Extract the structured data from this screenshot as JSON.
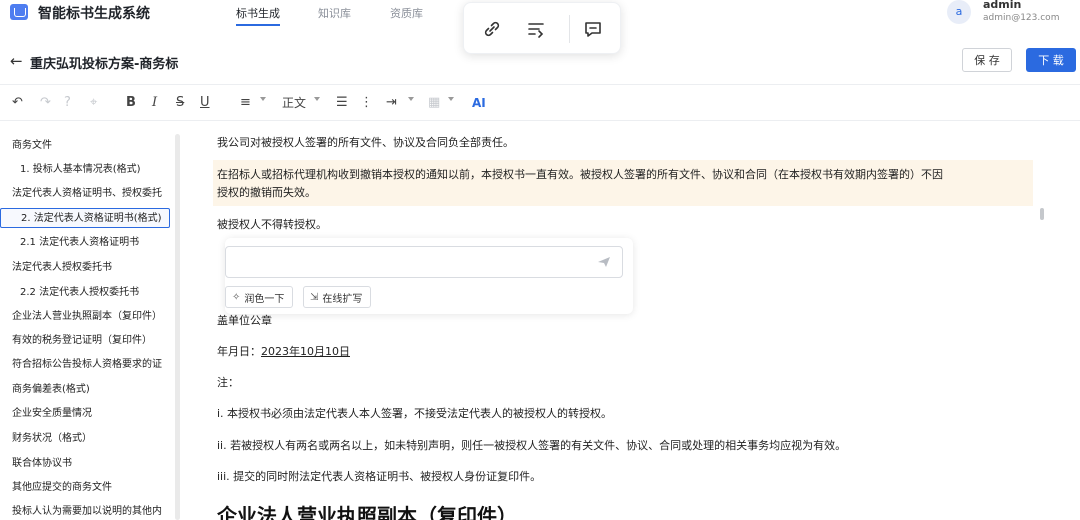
{
  "app": {
    "title": "智能标书生成系统",
    "tabs": [
      {
        "label": "标书生成",
        "active": true
      },
      {
        "label": "知识库",
        "active": false
      },
      {
        "label": "资质库",
        "active": false
      }
    ]
  },
  "user": {
    "avatar_letter": "a",
    "name": "admin",
    "email": "admin@123.com"
  },
  "popover": {
    "icons": [
      "link-icon",
      "rewrite-icon",
      "comment-icon"
    ]
  },
  "doc": {
    "title": "重庆弘玑投标方案-商务标",
    "save_label": "保 存",
    "download_label": "下 载"
  },
  "toolbar": {
    "paragraph_style": "正文",
    "ai_label": "AI",
    "bold": "B",
    "italic": "I",
    "strike": "S",
    "underline": "U"
  },
  "outline": [
    {
      "label": "商务文件",
      "level": 1
    },
    {
      "label": "1. 投标人基本情况表(格式)",
      "level": 2
    },
    {
      "label": "法定代表人资格证明书、授权委托",
      "level": 1
    },
    {
      "label": "2. 法定代表人资格证明书(格式)",
      "level": 2,
      "active": true
    },
    {
      "label": "2.1 法定代表人资格证明书",
      "level": 2
    },
    {
      "label": "法定代表人授权委托书",
      "level": 1
    },
    {
      "label": "2.2 法定代表人授权委托书",
      "level": 2
    },
    {
      "label": "企业法人营业执照副本（复印件）",
      "level": 1
    },
    {
      "label": "有效的税务登记证明（复印件）",
      "level": 1
    },
    {
      "label": "符合招标公告投标人资格要求的证",
      "level": 1
    },
    {
      "label": "商务偏差表(格式)",
      "level": 1
    },
    {
      "label": "企业安全质量情况",
      "level": 1
    },
    {
      "label": "财务状况（格式）",
      "level": 1
    },
    {
      "label": "联合体协议书",
      "level": 1
    },
    {
      "label": "其他应提交的商务文件",
      "level": 1
    },
    {
      "label": "投标人认为需要加以说明的其他内",
      "level": 1
    }
  ],
  "content": {
    "p1": "我公司对被授权人签署的所有文件、协议及合同负全部责任。",
    "hl_line1": "在招标人或招标代理机构收到撤销本授权的通知以前，本授权书一直有效。被授权人签署的所有文件、协议和合同（在本授权书有效期内签署的）不因",
    "hl_line2": "授权的撤销而失效。",
    "p3": "被授权人不得转授权。",
    "p_seal": "盖单位公章",
    "date_label": "年月日：",
    "date_value": "2023年10月10日",
    "note_label": "注：",
    "notes": [
      "i. 本授权书必须由法定代表人本人签署，不接受法定代表人的被授权人的转授权。",
      "ii. 若被授权人有两名或两名以上，如未特别声明，则任一被授权人签署的有关文件、协议、合同或处理的相关事务均应视为有效。",
      "iii. 提交的同时附法定代表人资格证明书、被授权人身份证复印件。"
    ],
    "heading": "企业法人营业执照副本（复印件）"
  },
  "ai_assist": {
    "placeholder": "",
    "chips": [
      {
        "icon": "polish-icon",
        "label": "润色一下"
      },
      {
        "icon": "expand-icon",
        "label": "在线扩写"
      }
    ]
  },
  "colors": {
    "accent": "#2b6ae0",
    "highlight_bg": "#fdf5e8"
  }
}
